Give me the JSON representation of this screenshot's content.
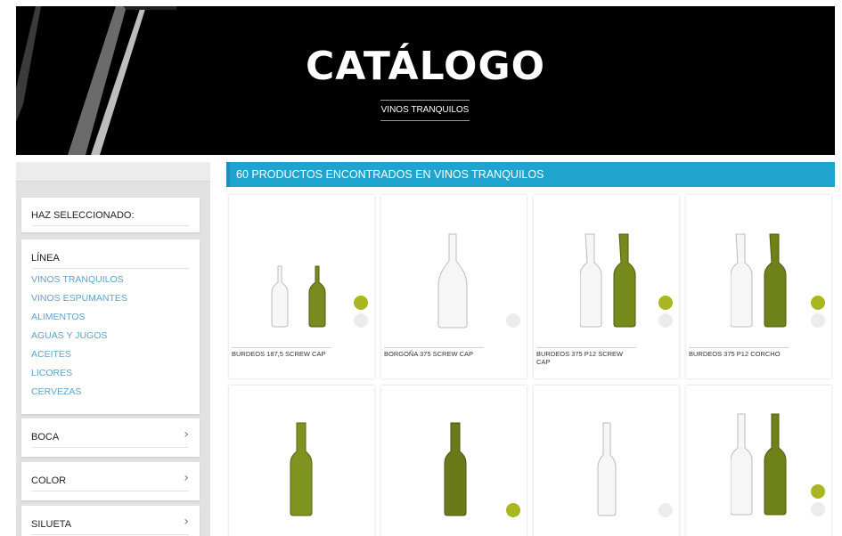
{
  "hero": {
    "title": "CATÁLOGO",
    "subtitle": "VINOS TRANQUILOS"
  },
  "sidebar": {
    "selected_title": "HAZ SELECCIONADO:",
    "linea": {
      "title": "LÍNEA",
      "items": [
        "VINOS TRANQUILOS",
        "VINOS ESPUMANTES",
        "ALIMENTOS",
        "AGUAS Y JUGOS",
        "ACEITES",
        "LICORES",
        "CERVEZAS"
      ]
    },
    "boca_label": "BOCA",
    "color_label": "COLOR",
    "silueta_label": "SILUETA"
  },
  "results": {
    "title": "60 PRODUCTOS ENCONTRADOS EN VINOS TRANQUILOS"
  },
  "products": [
    {
      "name": "BURDEOS 187,5 SCREW CAP",
      "colors": [
        "green",
        "white"
      ]
    },
    {
      "name": "BORGOÑA 375 SCREW CAP",
      "colors": [
        "white"
      ]
    },
    {
      "name": "BURDEOS 375 P12 SCREW CAP",
      "colors": [
        "green",
        "white"
      ]
    },
    {
      "name": "BURDEOS 375 P12 CORCHO",
      "colors": [
        "green",
        "white"
      ]
    },
    {
      "name": "",
      "colors": []
    },
    {
      "name": "",
      "colors": [
        "green"
      ]
    },
    {
      "name": "",
      "colors": [
        "white"
      ]
    },
    {
      "name": "",
      "colors": [
        "green",
        "white"
      ]
    }
  ],
  "icons": {
    "chevron": "chevron-right-icon",
    "swatch_green": "#a9b61f",
    "swatch_white": "#ececec",
    "accent": "#1fa3cf"
  }
}
